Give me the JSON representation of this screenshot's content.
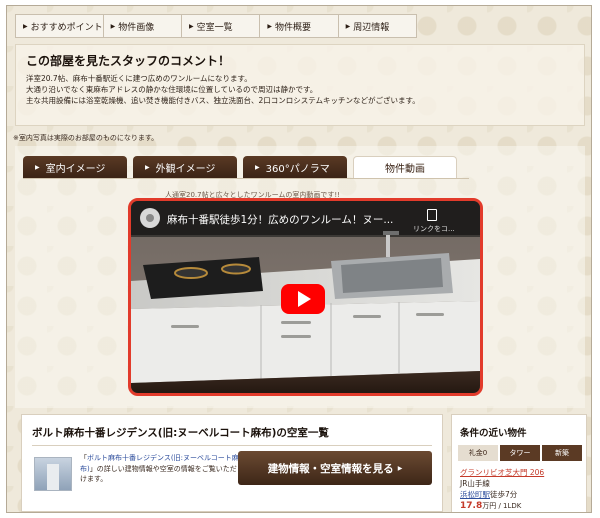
{
  "nav": {
    "items": [
      {
        "label": "おすすめポイント"
      },
      {
        "label": "物件画像"
      },
      {
        "label": "空室一覧"
      },
      {
        "label": "物件概要"
      },
      {
        "label": "周辺情報"
      }
    ]
  },
  "comment": {
    "title": "この部屋を見たスタッフのコメント！",
    "lines": [
      "洋室20.7帖、麻布十番駅近くに建つ広めのワンルームになります。",
      "大通り沿いでなく東麻布アドレスの静かな住環境に位置しているので周辺は静かです。",
      "主な共用設備には浴室乾燥機、追い焚き機能付きバス、独立洗面台、2口コンロシステムキッチンなどがございます。"
    ]
  },
  "photo_note": "※室内写真は実際のお部屋のものになります。",
  "media_tabs": [
    {
      "label": "室内イメージ"
    },
    {
      "label": "外観イメージ"
    },
    {
      "label": "360°パノラマ"
    },
    {
      "label": "物件動画"
    }
  ],
  "video": {
    "caption": "人通室20.7帖と広々としたワンルームの室内動画です!!",
    "title": "麻布十番駅徒歩1分！広めのワンルーム！ヌー...",
    "copy_label": "リンクをコ..."
  },
  "listing": {
    "title": "ボルト麻布十番レジデンス(旧:ヌーベルコート麻布)の空室一覧",
    "desc_pre": "「",
    "desc_link": "ボルト麻布十番レジデンス(旧:ヌーベルコート麻布)",
    "desc_post": "」の詳しい建物情報や空室の情報をご覧いただけます。",
    "cta_label": "建物情報・空室情報を見る"
  },
  "sidebar": {
    "title": "条件の近い物件",
    "tabs": [
      {
        "label": "礼金0"
      },
      {
        "label": "タワー"
      },
      {
        "label": "新築"
      }
    ],
    "property": {
      "name": "グランリビオ芝大門 206",
      "line": "JR山手線",
      "station": "浜松町駅",
      "walk": "徒歩7分",
      "price": "17.8",
      "price_unit": "万円 / 1LDK"
    }
  },
  "colors": {
    "accent_red": "#e23b2b",
    "tab_brown": "#3b2416",
    "link_blue": "#2d4d9c",
    "youtube_red": "#ff0000"
  },
  "icons": {
    "nav_arrow": "right-triangle-icon",
    "play": "youtube-play-icon",
    "copy": "copy-link-icon",
    "channel": "channel-avatar-icon"
  }
}
